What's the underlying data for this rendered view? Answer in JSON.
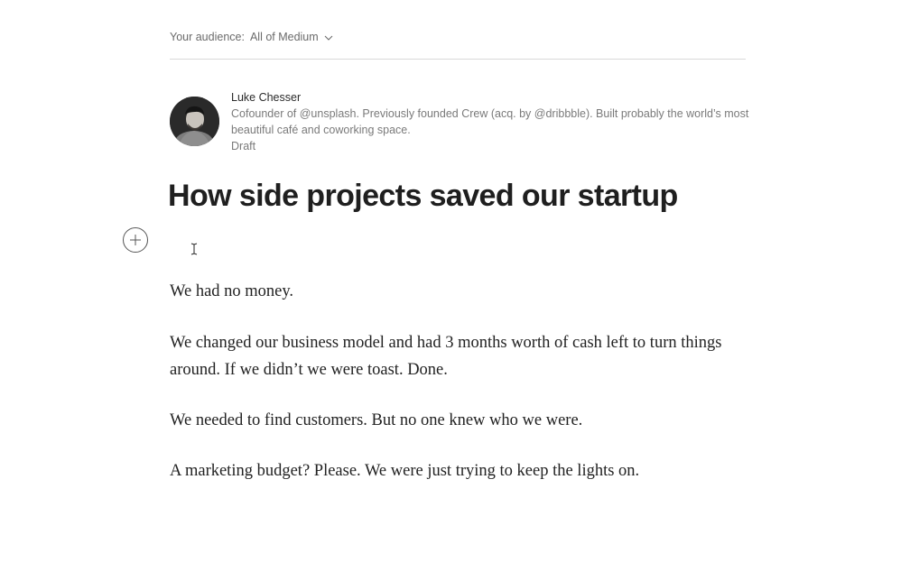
{
  "audience": {
    "label": "Your audience:",
    "value": "All of Medium"
  },
  "author": {
    "name": "Luke Chesser",
    "bio": "Cofounder of @unsplash. Previously founded Crew (acq. by @dribbble). Built probably the world’s most beautiful café and coworking space.",
    "status": "Draft"
  },
  "post": {
    "title": "How side projects saved our startup",
    "paragraphs": [
      "We had no money.",
      "We changed our business model and had 3 months worth of cash left to turn things around. If we didn’t we were toast. Done.",
      "We needed to find customers. But no one knew who we were.",
      "A marketing budget? Please. We were just trying to keep the lights on."
    ]
  },
  "icons": {
    "audience_dropdown": "chevron-down-icon",
    "add_content": "plus-circle-icon",
    "cursor": "text-cursor-icon"
  }
}
